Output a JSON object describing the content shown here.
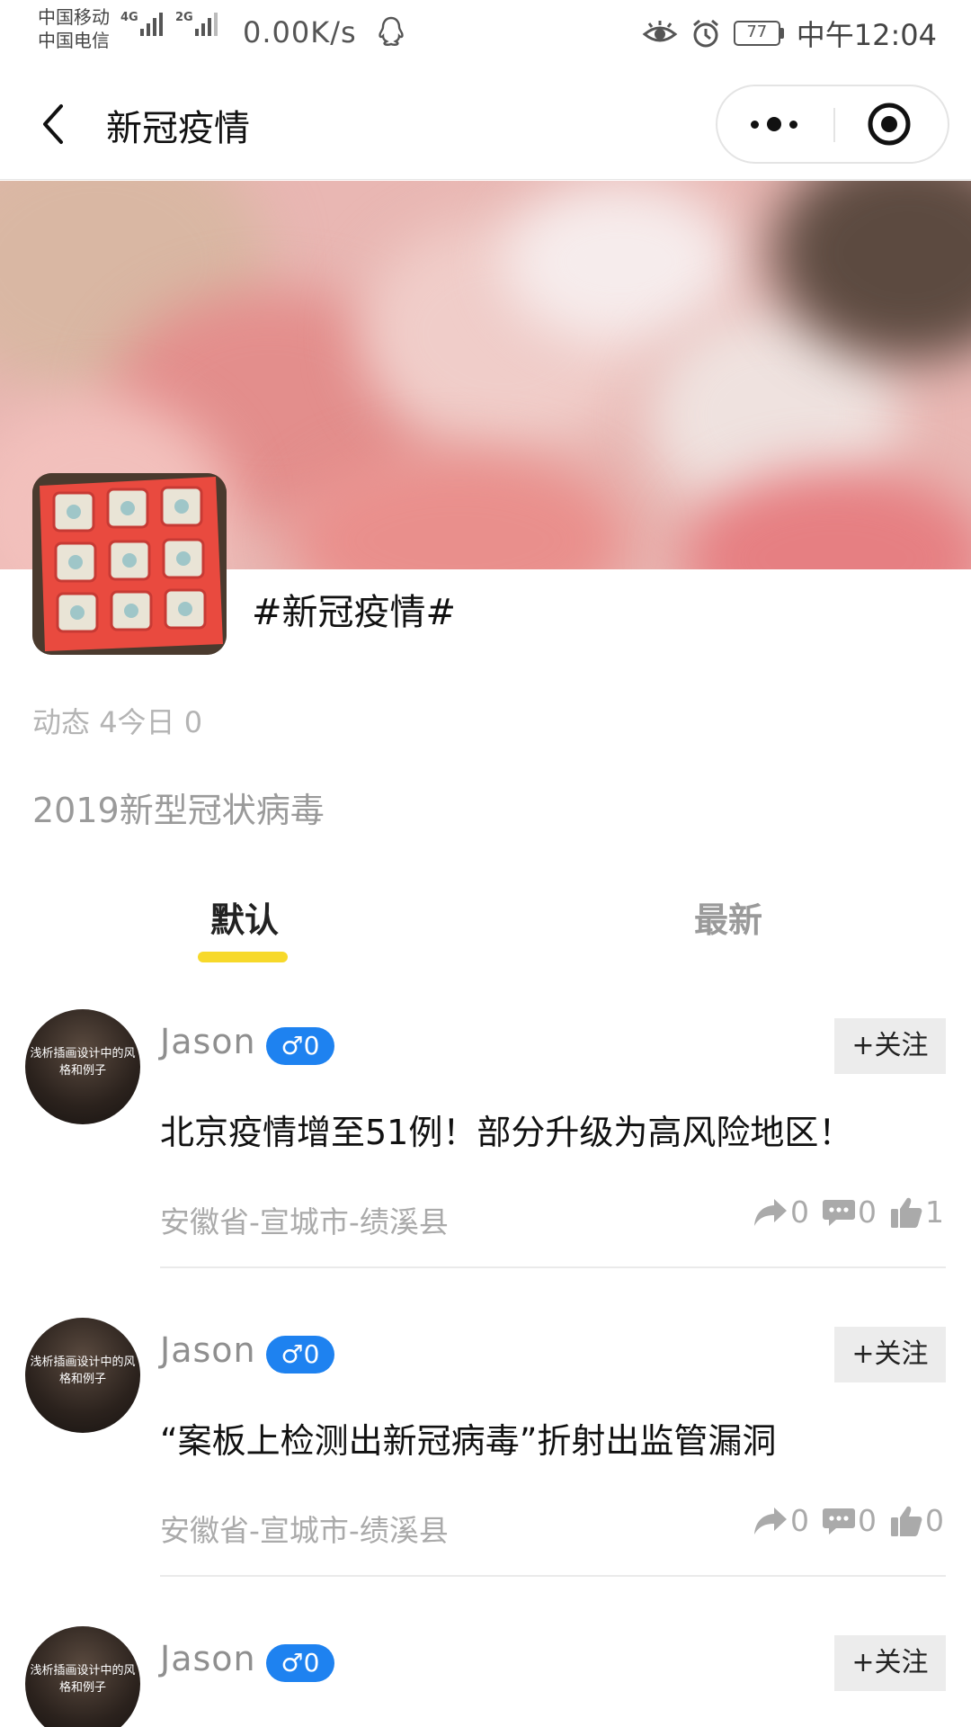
{
  "status_bar": {
    "carrier_1": "中国移动",
    "carrier_2": "中国电信",
    "net_1": "4G",
    "net_2": "2G",
    "speed": "0.00K/s",
    "battery": "77",
    "time": "中午12:04",
    "icons": [
      "signal-icon",
      "qq-icon",
      "eye-icon",
      "alarm-icon",
      "battery-icon"
    ]
  },
  "nav": {
    "title": "新冠疫情",
    "icons": [
      "back-icon",
      "more-icon",
      "target-icon"
    ]
  },
  "topic": {
    "name": "#新冠疫情#",
    "stats_label_posts": "动态",
    "stats_posts": "4",
    "stats_label_today": "今日",
    "stats_today": "0",
    "description": "2019新型冠状病毒"
  },
  "tabs": [
    {
      "label": "默认",
      "active": true
    },
    {
      "label": "最新",
      "active": false
    }
  ],
  "colors": {
    "accent": "#f7d92a",
    "badge": "#1e82f0",
    "muted": "#aaaaaa"
  },
  "posts": [
    {
      "user": "Jason",
      "gender_badge": "♂0",
      "avatar_text": "浅析插画设计中的风格和例子",
      "follow": "+关注",
      "title": "北京疫情增至51例！部分升级为高风险地区！",
      "location": "安徽省-宣城市-绩溪县",
      "shares": "0",
      "comments": "0",
      "likes": "1"
    },
    {
      "user": "Jason",
      "gender_badge": "♂0",
      "avatar_text": "浅析插画设计中的风格和例子",
      "follow": "+关注",
      "title": "“案板上检测出新冠病毒”折射出监管漏洞",
      "location": "安徽省-宣城市-绩溪县",
      "shares": "0",
      "comments": "0",
      "likes": "0"
    },
    {
      "user": "Jason",
      "gender_badge": "♂0",
      "avatar_text": "浅析插画设计中的风格和例子",
      "follow": "+关注"
    }
  ]
}
